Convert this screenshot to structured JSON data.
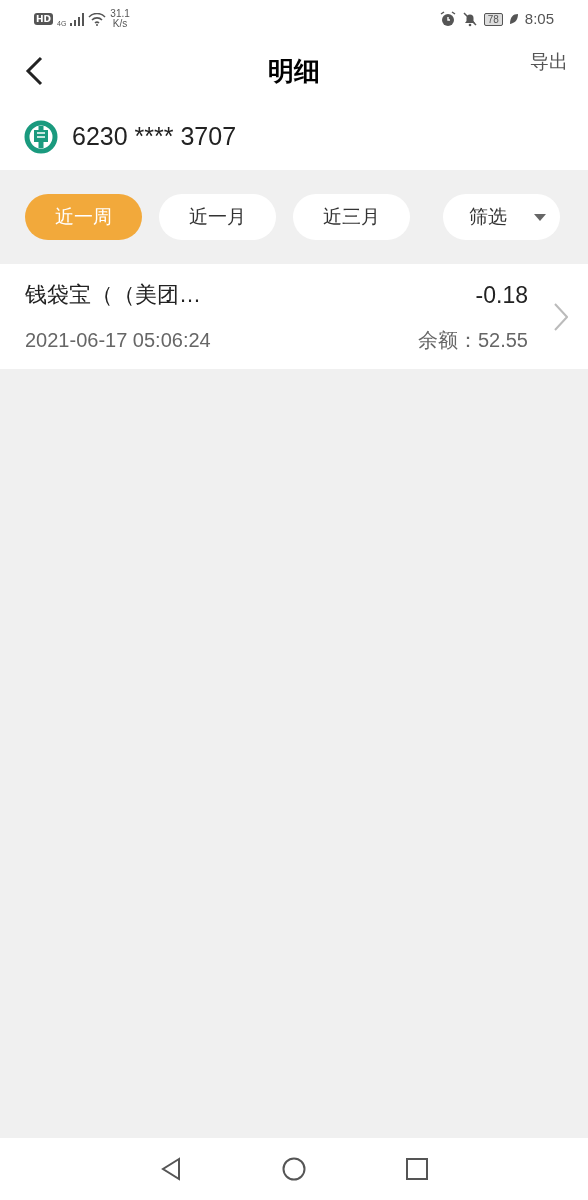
{
  "status_bar": {
    "hd": "HD",
    "network": "4G",
    "speed": "31.1",
    "speed_unit": "K/s",
    "battery": "78",
    "time": "8:05"
  },
  "header": {
    "title": "明细",
    "action": "导出"
  },
  "account": {
    "number": "6230 **** 3707"
  },
  "filters": [
    {
      "label": "近一周",
      "selected": true
    },
    {
      "label": "近一月",
      "selected": false
    },
    {
      "label": "近三月",
      "selected": false
    }
  ],
  "filter_dropdown": {
    "label": "筛选"
  },
  "transactions": [
    {
      "name": "钱袋宝（（美团…",
      "amount": "-0.18",
      "time": "2021-06-17 05:06:24",
      "balance": "余额：52.55"
    }
  ]
}
